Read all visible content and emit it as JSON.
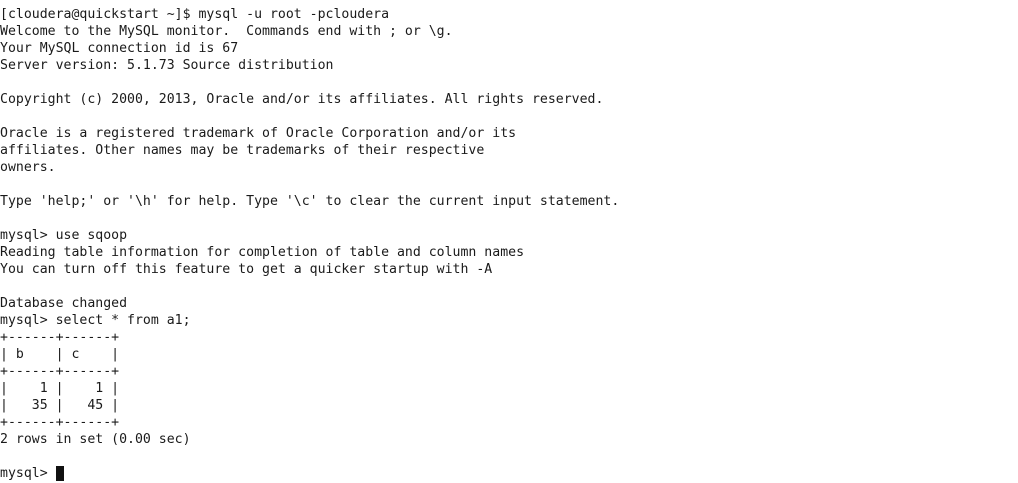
{
  "terminal": {
    "lines": [
      "",
      "[cloudera@quickstart ~]$ mysql -u root -pcloudera",
      "Welcome to the MySQL monitor.  Commands end with ; or \\g.",
      "Your MySQL connection id is 67",
      "Server version: 5.1.73 Source distribution",
      "",
      "Copyright (c) 2000, 2013, Oracle and/or its affiliates. All rights reserved.",
      "",
      "Oracle is a registered trademark of Oracle Corporation and/or its",
      "affiliates. Other names may be trademarks of their respective",
      "owners.",
      "",
      "Type 'help;' or '\\h' for help. Type '\\c' to clear the current input statement.",
      "",
      "mysql> use sqoop",
      "Reading table information for completion of table and column names",
      "You can turn off this feature to get a quicker startup with -A",
      "",
      "Database changed",
      "mysql> select * from a1;",
      "+------+------+",
      "| b    | c    |",
      "+------+------+",
      "|    1 |    1 |",
      "|   35 |   45 |",
      "+------+------+",
      "2 rows in set (0.00 sec)",
      ""
    ],
    "prompt": "mysql> "
  }
}
